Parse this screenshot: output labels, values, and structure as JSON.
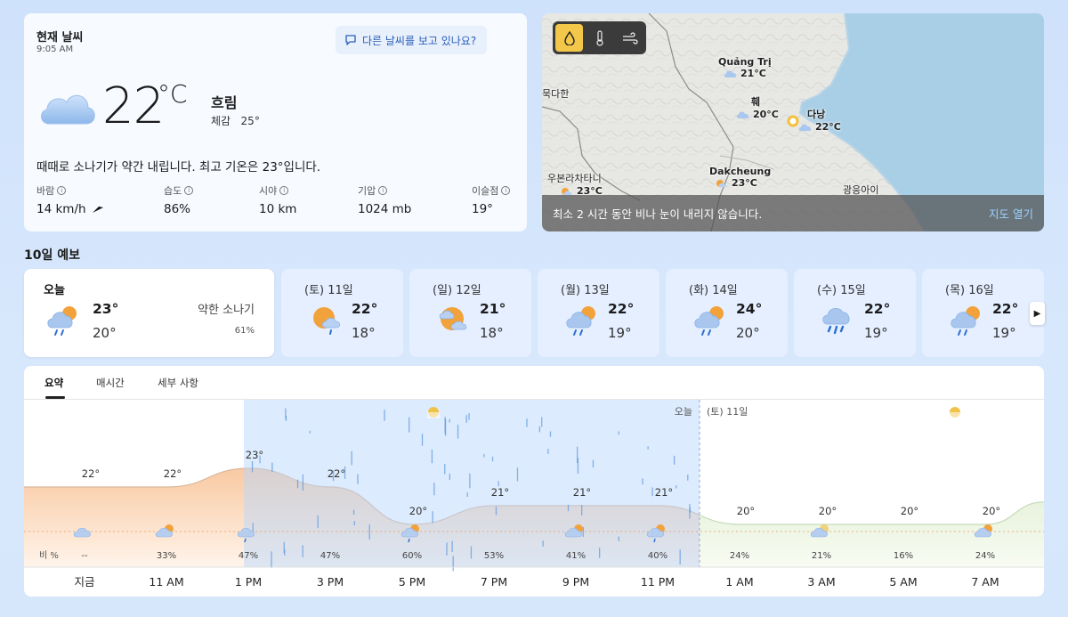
{
  "current": {
    "title": "현재 날씨",
    "time": "9:05 AM",
    "ask_button": "다른 날씨를 보고 있나요?",
    "temp": "22",
    "unit": "°C",
    "condition": "흐림",
    "feels_label": "체감",
    "feels_value": "25°",
    "description": "때때로 소나기가 약간 내립니다. 최고 기온은 23°입니다.",
    "stats": [
      {
        "label": "바람",
        "value": "14 km/h"
      },
      {
        "label": "습도",
        "value": "86%"
      },
      {
        "label": "시야",
        "value": "10 km"
      },
      {
        "label": "기압",
        "value": "1024 mb"
      },
      {
        "label": "이슬점",
        "value": "19°"
      }
    ]
  },
  "map": {
    "labels": [
      {
        "name": "Quảng Trị",
        "temp": "21°C"
      },
      {
        "name": "훼",
        "temp": "20°C"
      },
      {
        "name": "다낭",
        "temp": "22°C"
      },
      {
        "name": "묵다한",
        "temp": ""
      },
      {
        "name": "우본라차타니",
        "temp": "23°C"
      },
      {
        "name": "Dakcheung",
        "temp": "23°C"
      },
      {
        "name": "광응아이",
        "temp": ""
      }
    ],
    "footer_text": "최소 2 시간 동안 비나 눈이 내리지 않습니다.",
    "footer_link": "지도 열기",
    "active_layer": "precipitation"
  },
  "forecast": {
    "title": "10일 예보",
    "days": [
      {
        "day": "오늘",
        "hi": "23°",
        "lo": "20°",
        "caption": "약한 소나기",
        "pct": "61%",
        "icon": "partly-cloudy-rain-icon"
      },
      {
        "day": "(토) 11일",
        "hi": "22°",
        "lo": "18°",
        "icon": "sun-cloud-rain-icon"
      },
      {
        "day": "(일) 12일",
        "hi": "21°",
        "lo": "18°",
        "icon": "sun-cloud-icon"
      },
      {
        "day": "(월) 13일",
        "hi": "22°",
        "lo": "19°",
        "icon": "partly-cloudy-rain-icon"
      },
      {
        "day": "(화) 14일",
        "hi": "24°",
        "lo": "20°",
        "icon": "partly-cloudy-rain-icon"
      },
      {
        "day": "(수) 15일",
        "hi": "22°",
        "lo": "19°",
        "icon": "rain-cloud-icon"
      },
      {
        "day": "(목) 16일",
        "hi": "22°",
        "lo": "19°",
        "icon": "partly-cloudy-rain-icon"
      }
    ]
  },
  "tabs": [
    "요약",
    "매시간",
    "세부 사항"
  ],
  "chart_data": {
    "type": "area",
    "x": [
      "지금",
      "11 AM",
      "1 PM",
      "3 PM",
      "5 PM",
      "7 PM",
      "9 PM",
      "11 PM",
      "1 AM",
      "3 AM",
      "5 AM",
      "7 AM"
    ],
    "temps": [
      "22°",
      "22°",
      "23°",
      "22°",
      "20°",
      "21°",
      "21°",
      "21°",
      "20°",
      "20°",
      "20°",
      "20°"
    ],
    "temp_values": [
      22,
      22,
      23,
      22,
      20,
      21,
      21,
      21,
      20,
      20,
      20,
      20
    ],
    "precip_label": "비 %",
    "precip": [
      "--",
      "33%",
      "47%",
      "47%",
      "60%",
      "53%",
      "41%",
      "40%",
      "24%",
      "21%",
      "16%",
      "24%"
    ],
    "day_labels": [
      "오늘",
      "(토) 11일"
    ],
    "precip_band_range": [
      "1 PM",
      "11 PM"
    ],
    "day_divider_at": "1 AM"
  }
}
